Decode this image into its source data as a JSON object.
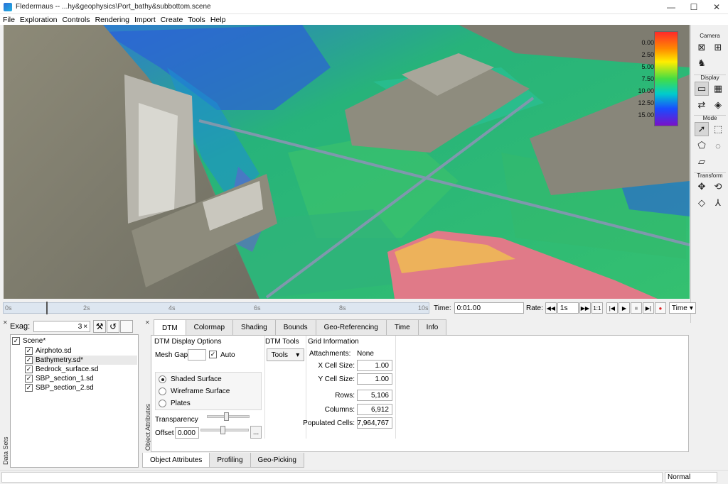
{
  "window": {
    "title": "Fledermaus -- ...hy&geophysics\\Port_bathy&subbottom.scene",
    "minimize": "—",
    "maximize": "☐",
    "close": "✕"
  },
  "menu": [
    "File",
    "Exploration",
    "Controls",
    "Rendering",
    "Import",
    "Create",
    "Tools",
    "Help"
  ],
  "colorbar": {
    "ticks": [
      "0.00",
      "2.50",
      "5.00",
      "7.50",
      "10.00",
      "12.50",
      "15.00"
    ]
  },
  "right_panel": {
    "camera": "Camera",
    "display": "Display",
    "mode": "Mode",
    "transform": "Transform"
  },
  "timeline": {
    "ticks": [
      "0s",
      "2s",
      "4s",
      "6s",
      "8s",
      "10s"
    ],
    "cursor_fraction": 0.1,
    "time_label": "Time:",
    "time_value": "0:01.00",
    "rate_label": "Rate:",
    "rate_value": "1s",
    "ratio": "1:1",
    "mode": "Time",
    "mode_arrow": "▾"
  },
  "data_sets": {
    "exag_label": "Exag:",
    "exag_value": "3",
    "exag_unit": "×",
    "vertical_label": "Data Sets",
    "tree": [
      {
        "label": "Scene*",
        "checked": true,
        "level": 0,
        "highlight": false
      },
      {
        "label": "Airphoto.sd",
        "checked": true,
        "level": 1,
        "highlight": false
      },
      {
        "label": "Bathymetry.sd*",
        "checked": true,
        "level": 1,
        "highlight": true
      },
      {
        "label": "Bedrock_surface.sd",
        "checked": true,
        "level": 1,
        "highlight": false
      },
      {
        "label": "SBP_section_1.sd",
        "checked": true,
        "level": 1,
        "highlight": false
      },
      {
        "label": "SBP_section_2.sd",
        "checked": true,
        "level": 1,
        "highlight": false
      }
    ]
  },
  "object_panel": {
    "vertical_label": "Object Attributes",
    "tabs": [
      "DTM",
      "Colormap",
      "Shading",
      "Bounds",
      "Geo-Referencing",
      "Time",
      "Info"
    ],
    "active_tab": "DTM",
    "display_options": {
      "title": "DTM Display Options",
      "mesh_gap_label": "Mesh Gap:",
      "mesh_gap_value": "",
      "auto_label": "Auto",
      "auto_checked": true,
      "render_modes": [
        {
          "label": "Shaded Surface",
          "selected": true
        },
        {
          "label": "Wireframe Surface",
          "selected": false
        },
        {
          "label": "Plates",
          "selected": false
        }
      ],
      "transparency_label": "Transparency",
      "transparency_level": 0.45,
      "offset_label": "Offset",
      "offset_value": "0.000",
      "offset_level": 0.45,
      "offset_button": "..."
    },
    "dtm_tools": {
      "title": "DTM Tools",
      "button": "Tools",
      "arrow": "▾"
    },
    "grid_info": {
      "title": "Grid Information",
      "attachments_label": "Attachments:",
      "attachments_value": "None",
      "fields": [
        {
          "label": "X Cell Size:",
          "value": "1.00"
        },
        {
          "label": "Y Cell Size:",
          "value": "1.00"
        },
        {
          "label": "Rows:",
          "value": "5,106"
        },
        {
          "label": "Columns:",
          "value": "6,912"
        },
        {
          "label": "Populated Cells:",
          "value": "7,964,767"
        }
      ]
    }
  },
  "bottom_tabs": [
    "Object Attributes",
    "Profiling",
    "Geo-Picking"
  ],
  "status": {
    "message": "",
    "mode": "Normal"
  }
}
